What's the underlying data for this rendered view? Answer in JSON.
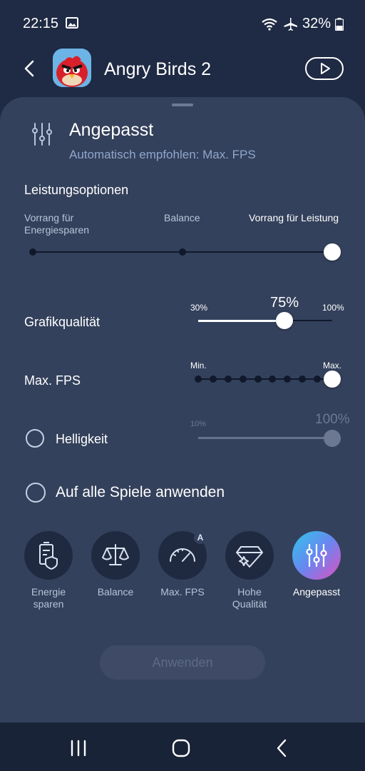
{
  "status": {
    "time": "22:15",
    "battery": "32%",
    "icons": [
      "image-icon",
      "wifi-icon",
      "airplane-icon",
      "battery-icon"
    ]
  },
  "header": {
    "title": "Angry Birds 2",
    "back_icon": "back-arrow-icon",
    "play_icon": "play-icon"
  },
  "mode": {
    "title": "Angepasst",
    "subtitle": "Automatisch empfohlen: Max. FPS"
  },
  "performance": {
    "title": "Leistungsoptionen",
    "options": [
      "Vorrang für\nEnergiesparen",
      "Balance",
      "Vorrang für Leistung"
    ],
    "selected_index": 2
  },
  "graphics": {
    "label": "Grafikqualität",
    "min_label": "30%",
    "max_label": "100%",
    "value_label": "75%",
    "value": 75,
    "min": 30,
    "max": 100
  },
  "fps": {
    "label": "Max. FPS",
    "min_label": "Min.",
    "max_label": "Max.",
    "steps": 10,
    "selected_step": 10
  },
  "brightness": {
    "label": "Helligkeit",
    "checked": false,
    "min_label": "10%",
    "value_label": "100%",
    "value": 100,
    "enabled": false
  },
  "apply_all": {
    "label": "Auf alle Spiele anwenden",
    "checked": false
  },
  "presets": [
    {
      "label": "Energie\nsparen",
      "icon": "battery-shield-icon",
      "selected": false
    },
    {
      "label": "Balance",
      "icon": "scale-icon",
      "selected": false
    },
    {
      "label": "Max. FPS",
      "icon": "speedometer-icon",
      "selected": false,
      "badge": "A"
    },
    {
      "label": "Hohe\nQualität",
      "icon": "diamond-icon",
      "selected": false
    },
    {
      "label": "Angepasst",
      "icon": "sliders-icon",
      "selected": true
    }
  ],
  "apply_button": {
    "label": "Anwenden",
    "enabled": false
  },
  "colors": {
    "background": "#1f2a44",
    "sheet": "#34415c",
    "accent_gradient": [
      "#38c6e8",
      "#6f7ef0",
      "#e05cc0"
    ]
  },
  "navbar": {
    "icons": [
      "recents-icon",
      "home-icon",
      "back-icon"
    ]
  }
}
